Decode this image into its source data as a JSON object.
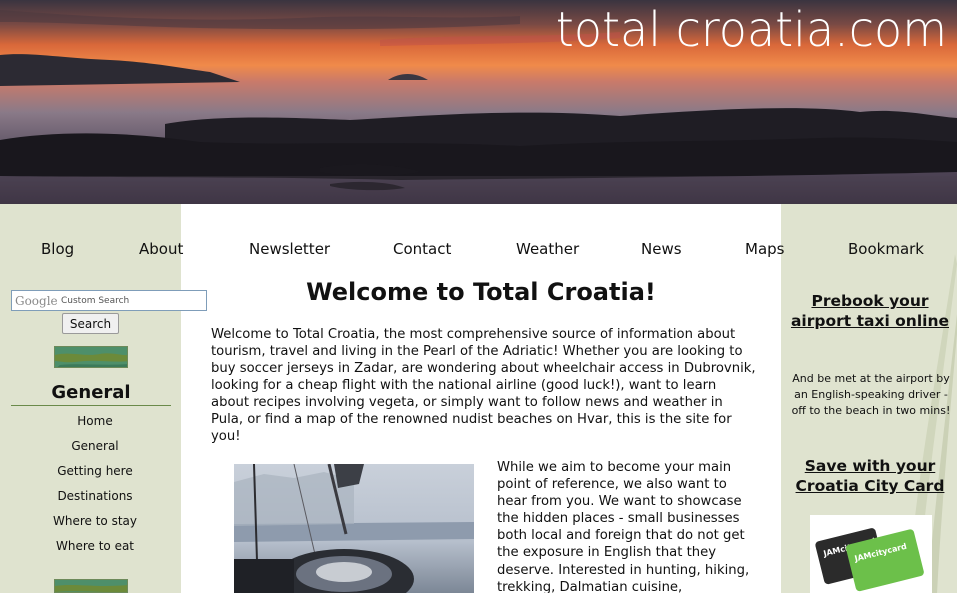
{
  "banner": {
    "brand": "total croatia.com"
  },
  "nav": {
    "items": [
      {
        "label": "Blog"
      },
      {
        "label": "About"
      },
      {
        "label": "Newsletter"
      },
      {
        "label": "Contact"
      },
      {
        "label": "Weather"
      },
      {
        "label": "News"
      },
      {
        "label": "Maps"
      },
      {
        "label": "Bookmark"
      }
    ]
  },
  "search": {
    "logo": "Google",
    "placeholder": "Custom Search",
    "button_label": "Search"
  },
  "sidebar": {
    "section_title": "General",
    "links": [
      {
        "label": "Home"
      },
      {
        "label": "General"
      },
      {
        "label": "Getting here"
      },
      {
        "label": "Destinations"
      },
      {
        "label": "Where to stay"
      },
      {
        "label": "Where to eat"
      }
    ]
  },
  "main": {
    "title": "Welcome to Total Croatia!",
    "intro": "Welcome to Total Croatia, the most comprehensive source of information about tourism, travel and living in the Pearl of the Adriatic! Whether you are looking to buy soccer jerseys in Zadar, are wondering about wheelchair access in Dubrovnik, looking for a cheap flight with the national airline (good luck!), want to learn about recipes involving vegeta, or simply want to follow news and weather in Pula, or find a map of the renowned nudist beaches on Hvar, this is the site for you!",
    "para2": "While we aim to become your main point of reference, we also want to hear from you. We want to showcase the hidden places - small businesses both local and foreign that do not get the exposure in English that they deserve. Interested in hunting, hiking, trekking, Dalmatian cuisine,"
  },
  "right": {
    "taxi_link": "Prebook your airport taxi online",
    "taxi_desc": "And be met at the airport by an English-speaking driver - off to the beach in two mins!",
    "card_link": "Save with your Croatia City Card",
    "card_text_1": "JAMcitycard",
    "card_text_2": "JAMcitycard"
  },
  "colors": {
    "sidebar_bg": "#dfe3cf",
    "content_bg": "#ffffff",
    "sunset_orange": "#e8743f"
  }
}
